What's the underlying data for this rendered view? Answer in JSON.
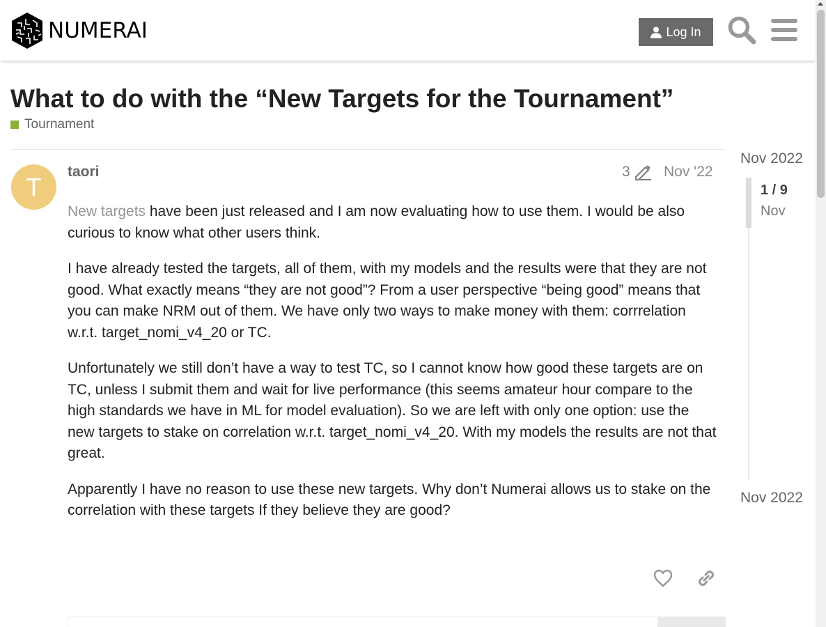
{
  "header": {
    "logo_text": "NUMERAI",
    "login_label": "Log In"
  },
  "topic": {
    "title": "What to do with the “New Targets for the Tournament”",
    "category": "Tournament",
    "category_color": "#8cb03a"
  },
  "post": {
    "avatar_letter": "T",
    "avatar_color": "#f0cd7d",
    "username": "taori",
    "edit_count": "3",
    "date": "Nov '22",
    "link_text": "New targets",
    "p1_rest": " have been just released and I am now evaluating how to use them. I would be also curious to know what other users think.",
    "p2": "I have already tested the targets, all of them, with my models and the results were that they are not good. What exactly means “they are not good”? From a user perspective “being good” means that you can make NRM out of them. We have only two ways to make money with them: corrrelation w.r.t. target_nomi_v4_20 or TC.",
    "p3": "Unfortunately we still don’t have a way to test TC, so I cannot know how good these targets are on TC, unless I submit them and wait for live performance (this seems amateur hour compare to the high standards we have in ML for model evaluation). So we are left with only one option: use the new targets to stake on correlation w.r.t. target_nomi_v4_20. With my models the results are not that great.",
    "p4": "Apparently I have no reason to use these new targets. Why don’t Numerai allows us to stake on the correlation with these targets If they believe they are good?"
  },
  "timeline": {
    "start_date": "Nov 2022",
    "position": "1 / 9",
    "current_month": "Nov",
    "end_date": "Nov 2022"
  },
  "icons": {
    "login": "user-icon",
    "search": "search-icon",
    "menu": "hamburger-menu-icon",
    "edit": "pencil-icon",
    "like": "heart-icon",
    "share": "link-icon"
  }
}
